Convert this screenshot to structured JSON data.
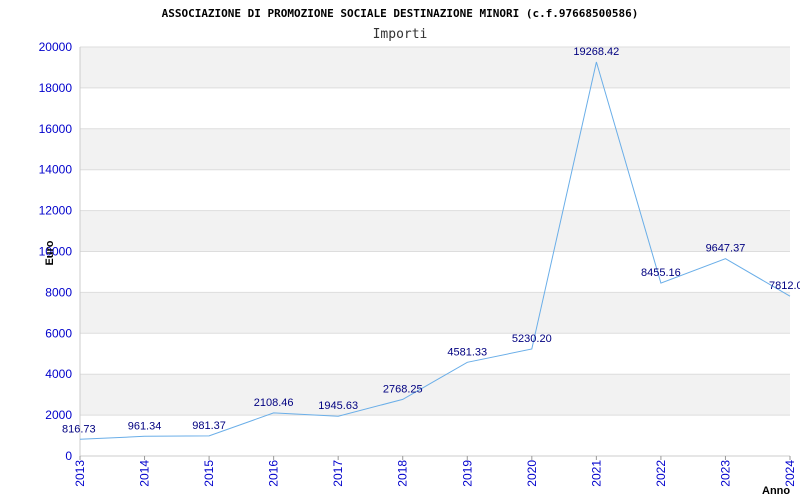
{
  "chart_data": {
    "type": "line",
    "title": "ASSOCIAZIONE DI PROMOZIONE SOCIALE DESTINAZIONE MINORI (c.f.97668500586)",
    "subtitle": "Importi",
    "xlabel": "Anno",
    "ylabel": "Euro",
    "categories": [
      "2013",
      "2014",
      "2015",
      "2016",
      "2017",
      "2018",
      "2019",
      "2020",
      "2021",
      "2022",
      "2023",
      "2024"
    ],
    "series": [
      {
        "values": [
          816.73,
          961.34,
          981.37,
          2108.46,
          1945.63,
          2768.25,
          4581.33,
          5230.2,
          19268.42,
          8455.16,
          9647.37,
          7812.0
        ],
        "labels": [
          "816.73",
          "961.34",
          "981.37",
          "2108.46",
          "1945.63",
          "2768.25",
          "4581.33",
          "5230.20",
          "19268.42",
          "8455.16",
          "9647.37",
          "7812.0"
        ]
      }
    ],
    "ylim": [
      0,
      20000
    ],
    "yticks": [
      "0",
      "2000",
      "4000",
      "6000",
      "8000",
      "10000",
      "12000",
      "14000",
      "16000",
      "18000",
      "20000"
    ],
    "grid": true,
    "colors": {
      "line": "#6aaee8",
      "band": "#f2f2f2",
      "tick": "#0000cc",
      "data_label": "#000080"
    }
  }
}
